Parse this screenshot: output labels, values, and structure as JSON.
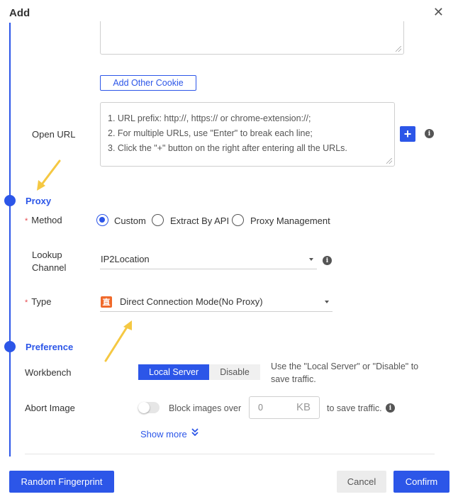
{
  "dialog": {
    "title": "Add",
    "close_symbol": "✕"
  },
  "cookie": {
    "add_other_label": "Add Other Cookie"
  },
  "open_url": {
    "label": "Open URL",
    "lines": [
      "1. URL prefix: http://, https:// or chrome-extension://;",
      "2. For multiple URLs, use \"Enter\" to break each line;",
      "3. Click the \"+\" button on the right after entering all the URLs."
    ],
    "add_symbol": "+"
  },
  "proxy": {
    "section_title": "Proxy",
    "method": {
      "label": "Method",
      "required_mark": "*",
      "options": [
        "Custom",
        "Extract By API",
        "Proxy Management"
      ],
      "selected": "Custom"
    },
    "lookup": {
      "label_line1": "Lookup",
      "label_line2": "Channel",
      "value": "IP2Location"
    },
    "type": {
      "label": "Type",
      "required_mark": "*",
      "icon_glyph": "直",
      "value": "Direct Connection Mode(No Proxy)"
    }
  },
  "preference": {
    "section_title": "Preference",
    "workbench": {
      "label": "Workbench",
      "options": [
        "Local Server",
        "Disable"
      ],
      "selected": "Local Server",
      "hint_line1": "Use the \"Local Server\" or \"Disable\" to",
      "hint_line2": "save traffic."
    },
    "abort_image": {
      "label": "Abort Image",
      "toggle_on": false,
      "prefix_text": "Block images over",
      "value": "0",
      "unit": "KB",
      "suffix_text": "to save traffic."
    },
    "show_more": "Show more"
  },
  "footer": {
    "random_fingerprint": "Random Fingerprint",
    "cancel": "Cancel",
    "confirm": "Confirm"
  },
  "colors": {
    "accent": "#2c56e8",
    "annotation_arrow": "#f5c842",
    "type_icon": "#f0692a",
    "required": "#e5484d"
  },
  "icons": {
    "close": "close-icon",
    "add": "plus-icon",
    "info": "info-icon",
    "caret": "caret-down-icon",
    "show_more": "double-chevron-down-icon",
    "annotation": "arrow-annotation-icon"
  }
}
